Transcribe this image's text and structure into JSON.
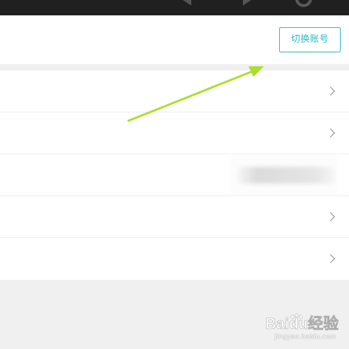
{
  "header": {
    "switch_account_label": "切换账号"
  },
  "list": {
    "items": [
      {
        "chevron": true
      },
      {
        "chevron": true
      },
      {
        "chevron": false,
        "blurred": true
      },
      {
        "chevron": true
      },
      {
        "chevron": true
      }
    ]
  },
  "annotation": {
    "arrow_color": "#a8e02a"
  },
  "watermark": {
    "brand": "Baidu经验",
    "sub": "jingyan.baidu.com"
  },
  "colors": {
    "accent": "#29b6c8",
    "top_bar": "#202020",
    "page_bg": "#f0f0f0"
  }
}
